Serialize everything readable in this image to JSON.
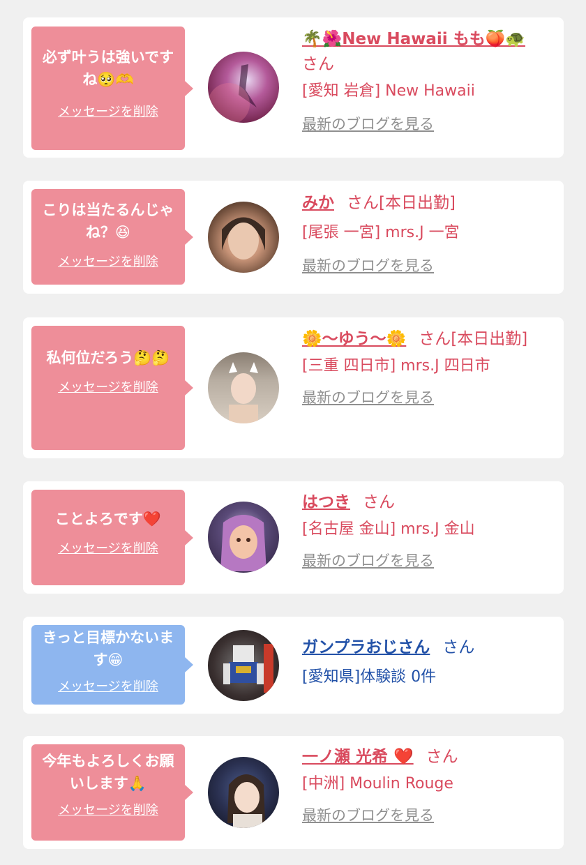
{
  "cards": [
    {
      "message": "必ず叶うは強いですね🥺🫶",
      "delete_label": "メッセージを削除",
      "name": "🌴🌺New Hawaii もも🍑🐢",
      "san": "さん",
      "area": "[愛知 岩倉] New Hawaii",
      "blog_label": "最新のブログを見る"
    },
    {
      "message": "こりは当たるんじゃね？😆",
      "delete_label": "メッセージを削除",
      "name": "みか",
      "san": "さん[本日出勤]",
      "area": "[尾張 一宮] mrs.J 一宮",
      "blog_label": "最新のブログを見る"
    },
    {
      "message": "私何位だろう🤔🤔",
      "delete_label": "メッセージを削除",
      "name": "🌼〜ゆう〜🌼",
      "san": "さん[本日出勤]",
      "area": "[三重 四日市] mrs.J 四日市",
      "blog_label": "最新のブログを見る"
    },
    {
      "message": "ことよろです❤️",
      "delete_label": "メッセージを削除",
      "name": "はつき",
      "san": "さん",
      "area": "[名古屋 金山] mrs.J 金山",
      "blog_label": "最新のブログを見る"
    },
    {
      "message": "きっと目標かないます😁",
      "delete_label": "メッセージを削除",
      "name": "ガンプラおじさん",
      "san": "さん",
      "area": "[愛知県]体験談 0件"
    },
    {
      "message": "今年もよろしくお願いします🙏",
      "delete_label": "メッセージを削除",
      "name": "一ノ瀬 光希 ❤️",
      "san": "さん",
      "area": "[中洲] Moulin Rouge",
      "blog_label": "最新のブログを見る"
    }
  ]
}
